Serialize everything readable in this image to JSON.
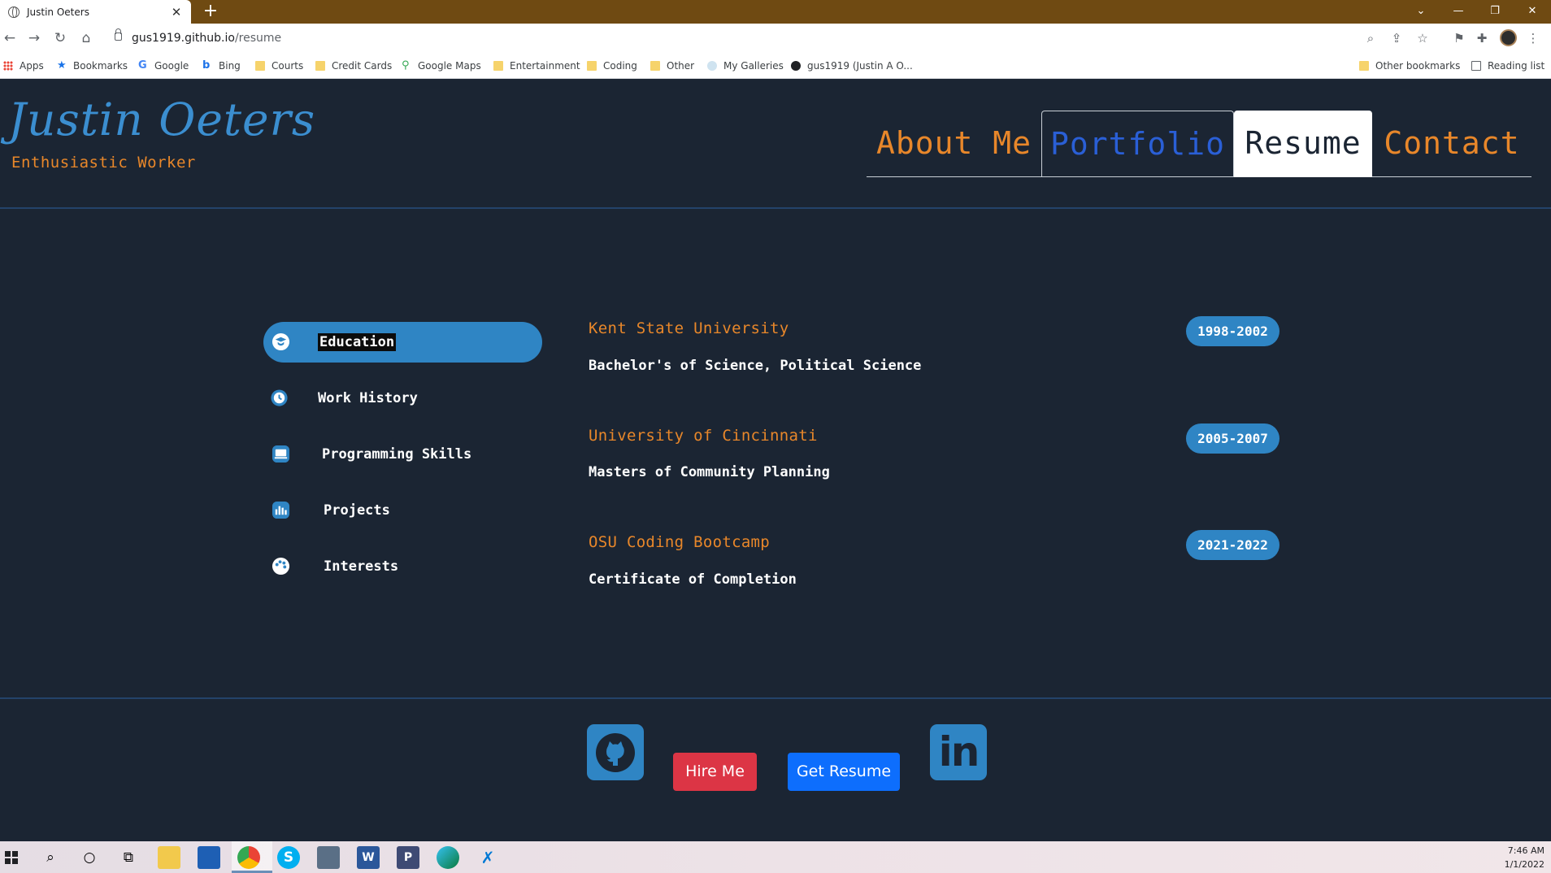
{
  "browser": {
    "tab_title": "Justin Oeters",
    "tab_close": "✕",
    "new_tab": "+",
    "url_host": "gus1919.github.io",
    "url_path": "/resume",
    "bookmarks": [
      {
        "label": "Apps",
        "icon": "apps-grid-icon"
      },
      {
        "label": "Bookmarks",
        "icon": "star-icon"
      },
      {
        "label": "Google",
        "icon": "google-icon"
      },
      {
        "label": "Bing",
        "icon": "bing-icon"
      },
      {
        "label": "Courts",
        "icon": "folder-icon"
      },
      {
        "label": "Credit Cards",
        "icon": "folder-icon"
      },
      {
        "label": "Google Maps",
        "icon": "maps-pin-icon"
      },
      {
        "label": "Entertainment",
        "icon": "folder-icon"
      },
      {
        "label": "Coding",
        "icon": "folder-icon"
      },
      {
        "label": "Other",
        "icon": "folder-icon"
      },
      {
        "label": "My Galleries",
        "icon": "galleries-icon"
      },
      {
        "label": "gus1919 (Justin A O...",
        "icon": "github-icon"
      }
    ],
    "other_bookmarks": "Other bookmarks",
    "reading_list": "Reading list"
  },
  "site": {
    "name": "Justin Oeters",
    "tagline": "Enthusiastic Worker",
    "nav": {
      "about": "About Me",
      "portfolio": "Portfolio",
      "resume": "Resume",
      "contact": "Contact"
    },
    "active_nav": "Resume",
    "colors": {
      "background": "#1b2533",
      "accent_blue": "#2f85c4",
      "accent_orange": "#e8872a",
      "hire_red": "#dc3545",
      "resume_blue": "#0d6efd"
    }
  },
  "sidebar": {
    "items": [
      {
        "label": "Education",
        "icon": "graduate-icon",
        "active": true
      },
      {
        "label": "Work History",
        "icon": "clock-history-icon",
        "active": false
      },
      {
        "label": "Programming Skills",
        "icon": "laptop-icon",
        "active": false
      },
      {
        "label": "Projects",
        "icon": "bar-chart-icon",
        "active": false
      },
      {
        "label": "Interests",
        "icon": "palette-icon",
        "active": false
      }
    ]
  },
  "education": [
    {
      "school": "Kent State University",
      "degree": "Bachelor's of Science, Political Science",
      "years": "1998-2002"
    },
    {
      "school": "University of Cincinnati",
      "degree": "Masters of Community Planning",
      "years": "2005-2007"
    },
    {
      "school": "OSU Coding Bootcamp",
      "degree": "Certificate of Completion",
      "years": "2021-2022"
    }
  ],
  "footer": {
    "hire_label": "Hire Me",
    "resume_label": "Get Resume",
    "github_icon": "github-icon",
    "linkedin_icon": "linkedin-icon",
    "linkedin_text": "in"
  },
  "taskbar": {
    "time": "7:46 AM",
    "date": "1/1/2022"
  }
}
